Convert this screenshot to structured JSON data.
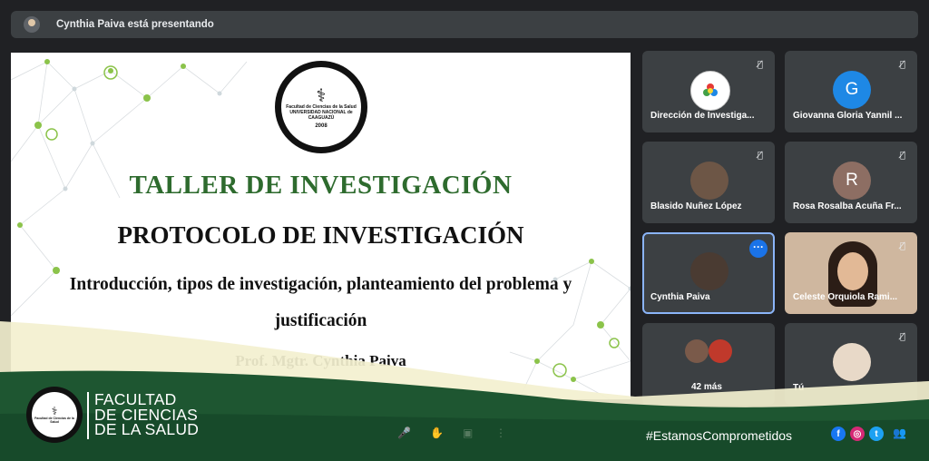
{
  "presenting_bar": {
    "text": "Cynthia Paiva está presentando"
  },
  "slide": {
    "logo_text": "Facultad de Ciencias de la Salud",
    "logo_university": "UNIVERSIDAD NACIONAL de CAAGUAZÚ",
    "logo_year": "2008",
    "title1": "TALLER DE INVESTIGACIÓN",
    "title2": "PROTOCOLO DE INVESTIGACIÓN",
    "subtitle": "Introducción, tipos de investigación, planteamiento del problema y justificación",
    "author": "Prof. Mgtr. Cynthia Paiva"
  },
  "participants": [
    {
      "name": "Dirección de Investiga...",
      "avatar_letter": "",
      "avatar_color": "#ffffff"
    },
    {
      "name": "Giovanna Gloria Yannil ...",
      "avatar_letter": "G",
      "avatar_color": "#1e88e5"
    },
    {
      "name": "Blasido Nuñez López",
      "avatar_letter": "",
      "avatar_color": "#6d5646"
    },
    {
      "name": "Rosa Rosalba Acuña Fr...",
      "avatar_letter": "R",
      "avatar_color": "#8d6e63"
    },
    {
      "name": "Cynthia Paiva",
      "avatar_letter": "",
      "avatar_color": "#4a3b32"
    },
    {
      "name": "Celeste Orquiola Rami...",
      "avatar_letter": "",
      "avatar_color": "#d8b89a"
    },
    {
      "name": "42 más",
      "avatar_letter": "",
      "avatar_color": "#7a5a4a"
    },
    {
      "name": "Tú",
      "avatar_letter": "",
      "avatar_color": "#e8d9c8"
    }
  ],
  "banner": {
    "faculty_line1": "FACULTAD",
    "faculty_line2": "DE CIENCIAS",
    "faculty_line3": "DE LA SALUD",
    "hashtag": "#EstamosComprometidos",
    "social": [
      "f",
      "ig",
      "tw"
    ]
  },
  "colors": {
    "accent_green": "#2e6b2e",
    "banner_green": "#1e5631",
    "banner_cream": "#f3f0cf",
    "meet_bg": "#202124",
    "tile_bg": "#3c4043",
    "active_border": "#8ab4f8",
    "more_button": "#1a73e8"
  }
}
